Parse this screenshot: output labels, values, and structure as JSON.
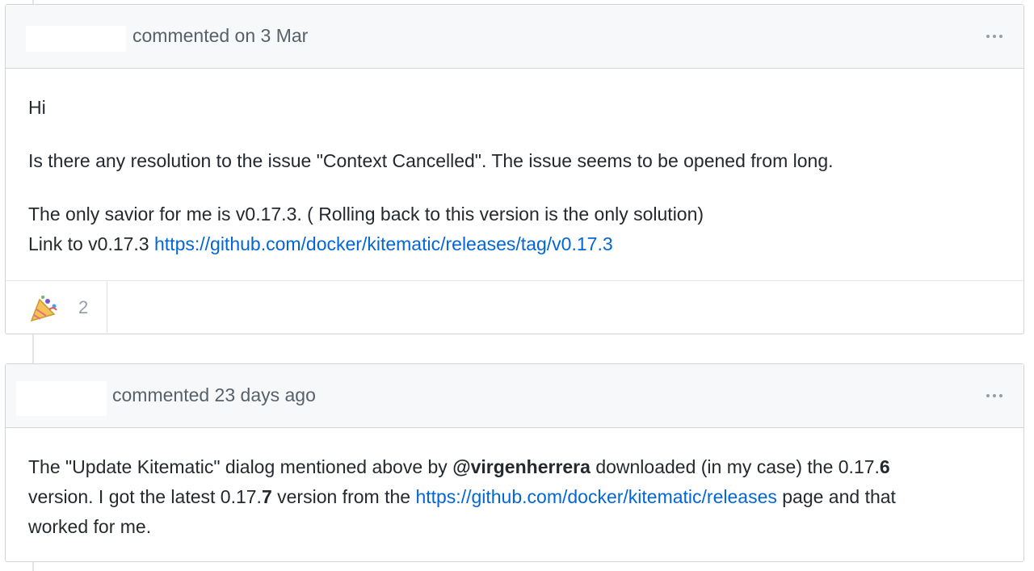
{
  "comments": [
    {
      "header": {
        "text": "commented on 3 Mar"
      },
      "body": {
        "greeting": "Hi",
        "paragraph1": "Is there any resolution to the issue \"Context Cancelled\". The issue seems to be opened from long.",
        "paragraph2_line1": "The only savior for me is v0.17.3. ( Rolling back to this version is the only solution)",
        "paragraph2_line2_prefix": "Link to v0.17.3 ",
        "link": "https://github.com/docker/kitematic/releases/tag/v0.17.3"
      },
      "reactions": [
        {
          "emoji_name": "tada-icon",
          "count": "2"
        }
      ]
    },
    {
      "header": {
        "text": "commented 23 days ago"
      },
      "body": {
        "part1": "The \"Update Kitematic\" dialog mentioned above by ",
        "mention": "@virgenherrera",
        "part2": " downloaded (in my case) the 0.17.",
        "bold1": "6",
        "part3": "version. I got the latest 0.17.",
        "bold2": "7",
        "part4": " version from the ",
        "link": "https://github.com/docker/kitematic/releases",
        "part5": " page and that",
        "part6": "worked for me."
      }
    }
  ]
}
